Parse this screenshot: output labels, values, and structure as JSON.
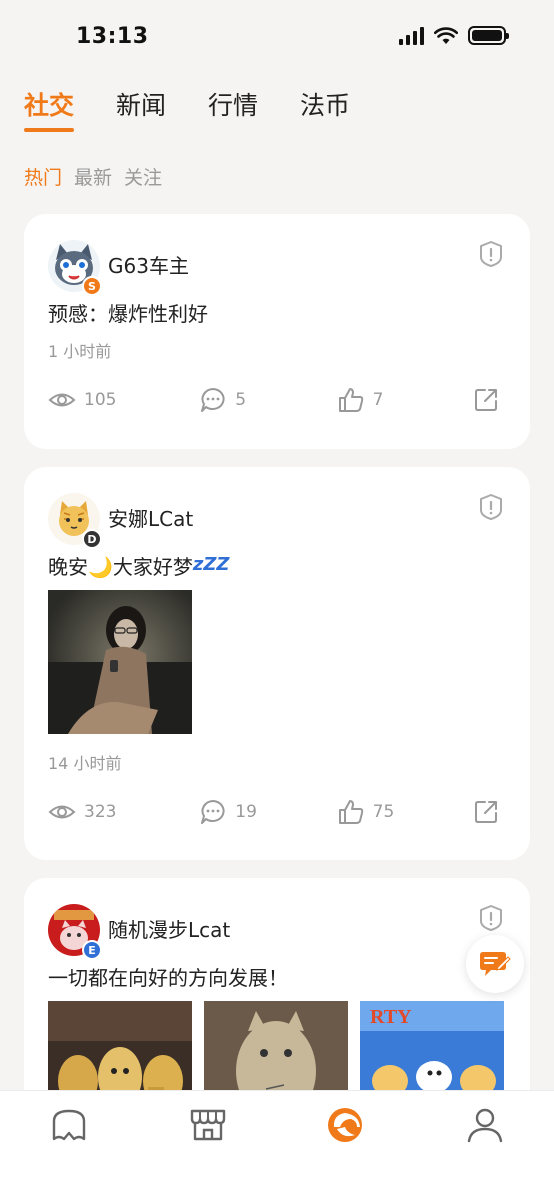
{
  "status": {
    "time": "13:13"
  },
  "top_tabs": [
    {
      "label": "社交"
    },
    {
      "label": "新闻"
    },
    {
      "label": "行情"
    },
    {
      "label": "法币"
    }
  ],
  "sub_tabs": [
    {
      "label": "热门"
    },
    {
      "label": "最新"
    },
    {
      "label": "关注"
    }
  ],
  "posts": [
    {
      "username": "G63车主",
      "badge": "S",
      "text": "预感：爆炸性利好",
      "time": "1 小时前",
      "views": "105",
      "comments": "5",
      "likes": "7"
    },
    {
      "username": "安娜LCat",
      "badge": "D",
      "text": "晚安🌙大家好梦",
      "zzz": "zZZ",
      "time": "14 小时前",
      "views": "323",
      "comments": "19",
      "likes": "75"
    },
    {
      "username": "随机漫步Lcat",
      "badge": "E",
      "text": "一切都在向好的方向发展！",
      "image_banner_text": "RTY"
    }
  ],
  "colors": {
    "accent": "#f07a1a",
    "badge_s": "#f07a1a",
    "badge_d": "#333333",
    "badge_e": "#2f6fd6"
  },
  "icons": [
    "report-icon",
    "eye-icon",
    "comment-icon",
    "thumbs-up-icon",
    "share-icon",
    "compose-icon",
    "home-icon",
    "market-icon",
    "social-icon",
    "profile-icon"
  ]
}
